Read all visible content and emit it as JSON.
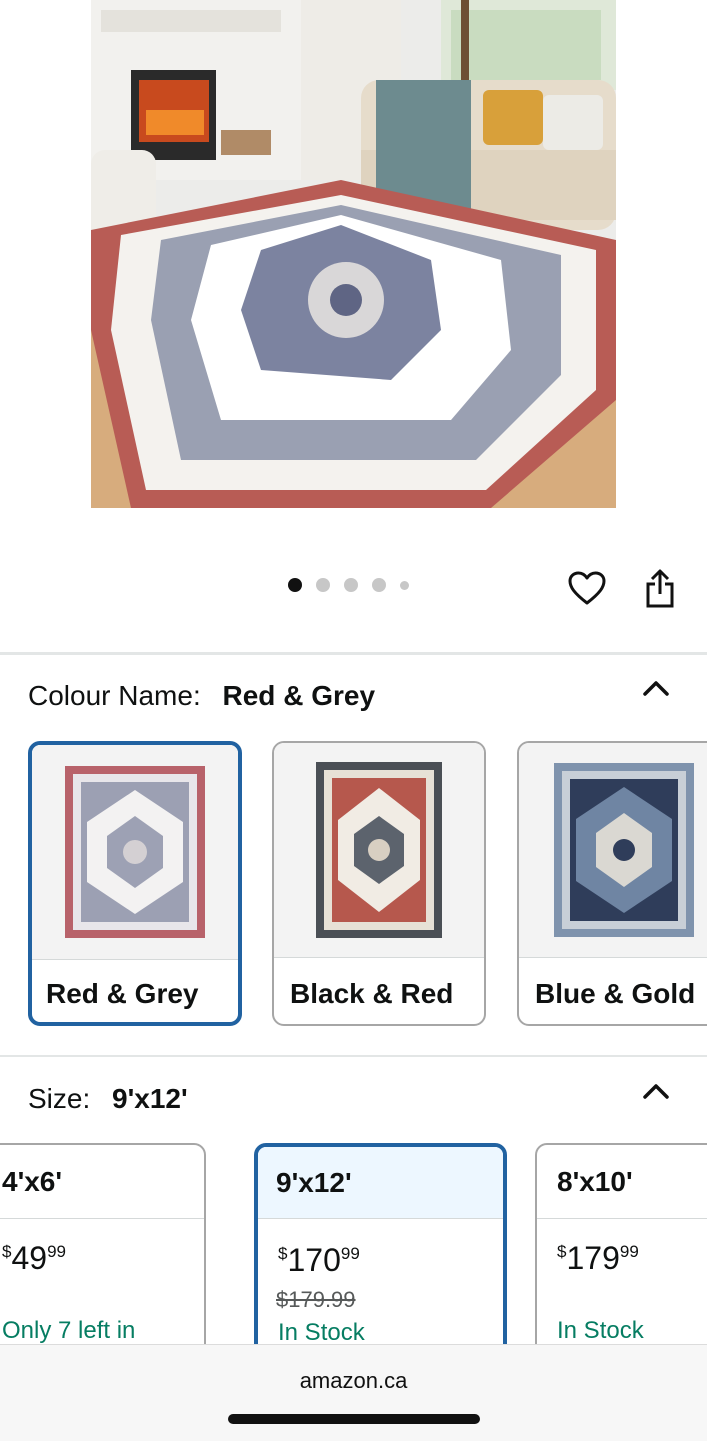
{
  "gallery": {
    "image_alt": "Rug in living room",
    "dots": [
      true,
      false,
      false,
      false,
      false
    ]
  },
  "actions": {
    "favorite_icon": "heart-icon",
    "share_icon": "share-icon"
  },
  "colour": {
    "label": "Colour Name:",
    "value": "Red & Grey",
    "options": [
      {
        "label": "Red & Grey",
        "selected": true
      },
      {
        "label": "Black & Red",
        "selected": false
      },
      {
        "label": "Blue & Gold",
        "selected": false
      }
    ]
  },
  "size": {
    "label": "Size:",
    "value": "9'x12'",
    "options": [
      {
        "label": "4'x6'",
        "currency": "$",
        "price_whole": "49",
        "price_frac": "99",
        "was": "",
        "stock": "Only 7 left in"
      },
      {
        "label": "9'x12'",
        "currency": "$",
        "price_whole": "170",
        "price_frac": "99",
        "was": "$179.99",
        "stock": "In Stock"
      },
      {
        "label": "8'x10'",
        "currency": "$",
        "price_whole": "179",
        "price_frac": "99",
        "was": "",
        "stock": "In Stock"
      }
    ]
  },
  "browser": {
    "url": "amazon.ca"
  },
  "colors": {
    "accent": "#2162a1",
    "in_stock": "#067d62"
  }
}
